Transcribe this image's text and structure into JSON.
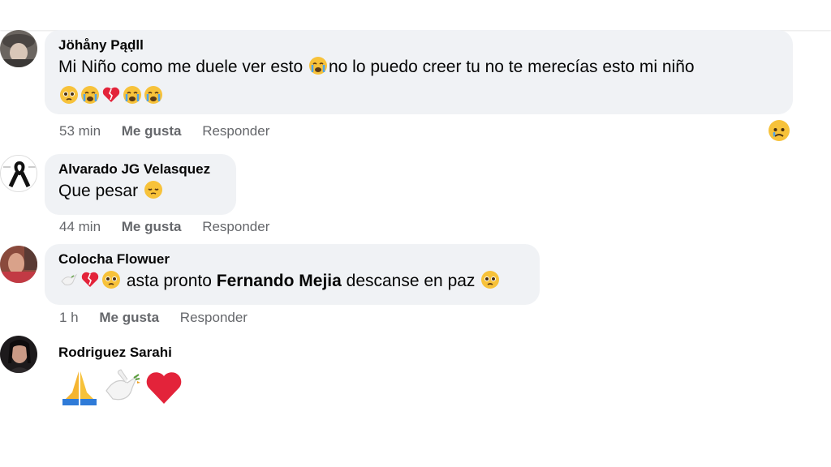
{
  "comments": [
    {
      "author": "Jöhåny Pąḍll",
      "text_1": "Mi Niño como me duele ver esto",
      "text_2": "no lo puedo creer tu no te merecías esto mi niño",
      "time": "53 min",
      "like_label": "Me gusta",
      "reply_label": "Responder",
      "reaction_icon": "sad-reaction-icon"
    },
    {
      "author": "Alvarado JG Velasquez",
      "text": "Que pesar",
      "time": "44 min",
      "like_label": "Me gusta",
      "reply_label": "Responder"
    },
    {
      "author": "Colocha Flowuer",
      "text_1": "asta pronto",
      "mention": "Fernando Mejia",
      "text_2": "descanse en paz",
      "time": "1 h",
      "like_label": "Me gusta",
      "reply_label": "Responder"
    },
    {
      "author": "Rodriguez Sarahi"
    }
  ],
  "colors": {
    "bubble": "#f0f2f5",
    "meta_text": "#65676b",
    "name_text": "#050505"
  }
}
